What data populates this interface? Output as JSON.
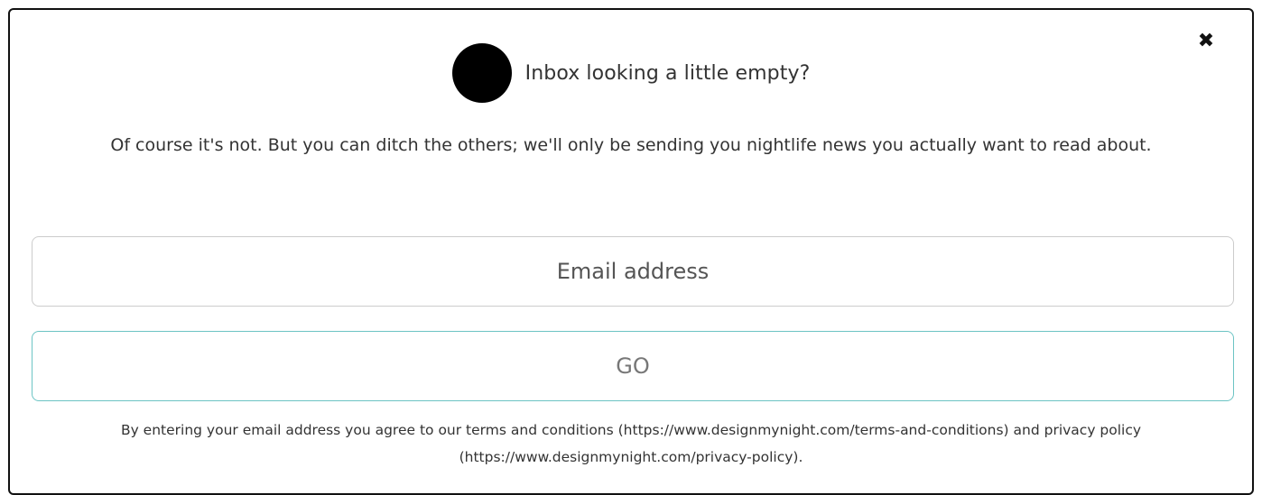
{
  "modal": {
    "close_icon": "close-icon",
    "title": "Inbox looking a little empty?",
    "description": "Of course it's not. But you can ditch the others; we'll only be sending you nightlife news you actually want to read about.",
    "email_placeholder": "Email address",
    "email_value": "",
    "go_label": "GO",
    "legal_text": "By entering your email address you agree to our terms and conditions (https://www.designmynight.com/terms-and-conditions) and privacy policy (https://www.designmynight.com/privacy-policy)."
  },
  "colors": {
    "border": "#111111",
    "input_border": "#cccccc",
    "button_border": "#6cc4c4",
    "avatar": "#000000"
  }
}
